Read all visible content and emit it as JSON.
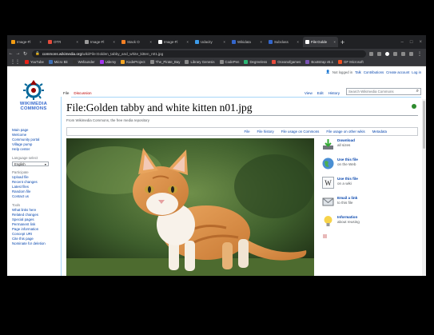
{
  "browser": {
    "tabs": [
      {
        "label": "Image-Fl",
        "color": "#f39c12",
        "active": false
      },
      {
        "label": "OTR",
        "color": "#e74c3c",
        "active": false
      },
      {
        "label": "Image-Fl",
        "color": "#9b9b9b",
        "active": false
      },
      {
        "label": "Stack O",
        "color": "#f48024",
        "active": false
      },
      {
        "label": "Image-Fl",
        "color": "#ffffff",
        "active": false
      },
      {
        "label": "Udacity",
        "color": "#3d9be9",
        "active": false
      },
      {
        "label": "Wikidata",
        "color": "#3366cc",
        "active": false
      },
      {
        "label": "Subclass",
        "color": "#3366cc",
        "active": false
      },
      {
        "label": "File:Golde",
        "color": "#ffffff",
        "active": true
      }
    ],
    "new_tab": "+",
    "window_controls": [
      "–",
      "□",
      "×"
    ],
    "url_prefix": "commons.wikimedia.org",
    "url_rest": "/wiki/File:Golden_tabby_and_white_kitten_n01.jpg",
    "bookmarks": [
      {
        "label": "YouTube",
        "color": "#e62117"
      },
      {
        "label": "Micro Bit",
        "color": "#3d6fb6"
      },
      {
        "label": "Wefounder",
        "color": "#333"
      },
      {
        "label": "Udemy",
        "color": "#a435f0"
      },
      {
        "label": "KodeProject",
        "color": "#f5a623"
      },
      {
        "label": "The_Pirate_Bay",
        "color": "#8a8a8a"
      },
      {
        "label": "Library Genesis",
        "color": "#8a8a8a"
      },
      {
        "label": "CodePen",
        "color": "#8a8a8a"
      },
      {
        "label": "Degreeless",
        "color": "#2bb673"
      },
      {
        "label": "Oceanofgames",
        "color": "#e74c3c"
      },
      {
        "label": "Bootstrap v5.1",
        "color": "#7952b3"
      },
      {
        "label": "GF Microsoft",
        "color": "#f25022"
      }
    ]
  },
  "wiki": {
    "personal": {
      "not_logged_in": "Not logged in",
      "talk": "Talk",
      "contributions": "Contributions",
      "create_account": "Create account",
      "login": "Log in"
    },
    "logo_text": "WIKIMEDIA COMMONS",
    "sidebar": {
      "nav": [
        "Main page",
        "Welcome",
        "Community portal",
        "Village pump",
        "Help center"
      ],
      "language_head": "Language select",
      "language_value": "English",
      "participate_head": "Participate",
      "participate": [
        "Upload file",
        "Recent changes",
        "Latest files",
        "Random file",
        "Contact us"
      ],
      "tools_head": "Tools",
      "tools": [
        "What links here",
        "Related changes",
        "Special pages",
        "Permanent link",
        "Page information",
        "Concept URI",
        "Cite this page",
        "Nominate for deletion"
      ]
    },
    "tabs": {
      "file": "File",
      "discussion": "Discussion",
      "view": "View",
      "edit": "Edit",
      "history": "History"
    },
    "search_placeholder": "Search Wikimedia Commons",
    "title": "File:Golden tabby and white kitten n01.jpg",
    "tagline": "From Wikimedia Commons, the free media repository",
    "file_toc": [
      "File",
      "File history",
      "File usage on Commons",
      "File usage on other wikis",
      "Metadata"
    ],
    "actions": [
      {
        "title": "Download",
        "sub": "all sizes",
        "icon": "download-icon"
      },
      {
        "title": "Use this file",
        "sub": "on the Web",
        "icon": "globe-icon"
      },
      {
        "title": "Use this file",
        "sub": "on a wiki",
        "icon": "wikipedia-icon"
      },
      {
        "title": "Email a link",
        "sub": "to this file",
        "icon": "email-icon"
      },
      {
        "title": "Information",
        "sub": "about reusing",
        "icon": "lightbulb-icon"
      }
    ]
  }
}
